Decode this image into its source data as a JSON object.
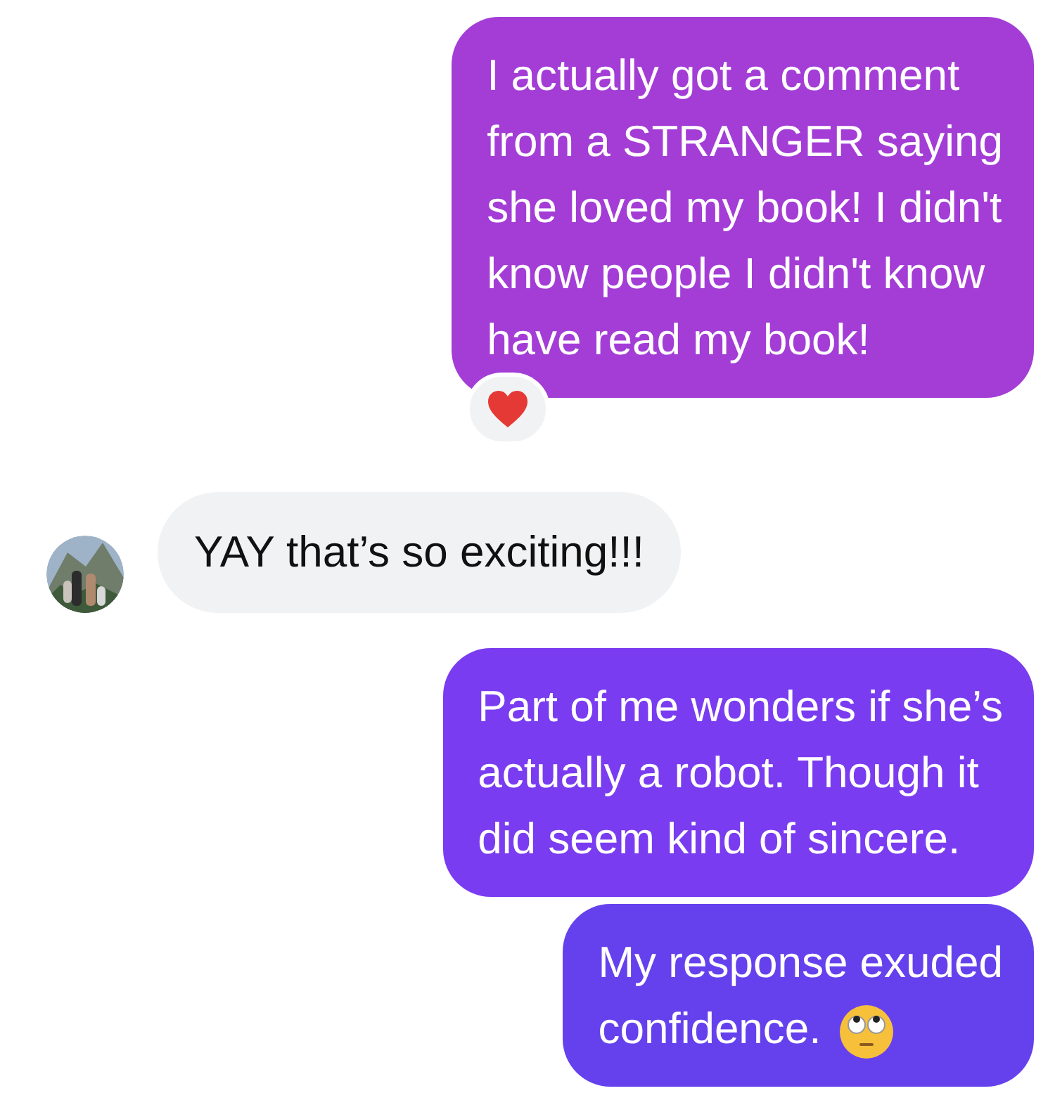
{
  "messages": [
    {
      "kind": "outgoing",
      "text": "I actually got a comment\nfrom a STRANGER saying\nshe loved my book! I didn't\nknow people I didn't know\nhave read my book!",
      "heart_reaction": true
    },
    {
      "kind": "incoming",
      "text": "YAY that’s so exciting!!!",
      "has_avatar": true
    },
    {
      "kind": "outgoing",
      "text": "Part of me wonders if she’s\nactually a robot. Though it\ndid seem kind of sincere."
    },
    {
      "kind": "outgoing",
      "text": "My response exuded\nconfidence.",
      "eye_roll_emoji": true
    }
  ]
}
